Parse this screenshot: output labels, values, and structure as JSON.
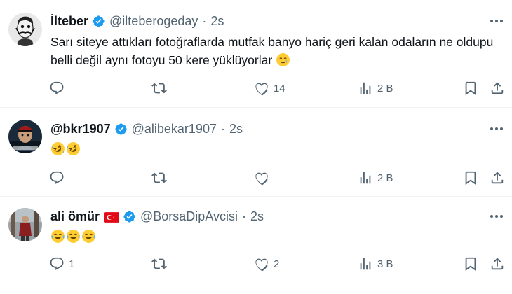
{
  "tweets": [
    {
      "name": "İlteber",
      "handle": "@ilteberogeday",
      "time": "2s",
      "text": "Sarı siteye attıkları fotoğraflarda mutfak banyo hariç geri kalan odaların ne oldupu belli değil aynı fotoyu 50 kere yüklüyorlar",
      "emoji": [
        "smiling-face-with-tear"
      ],
      "replies": "",
      "retweets": "",
      "likes": "14",
      "views": "2 B"
    },
    {
      "name": "@bkr1907",
      "handle": "@alibekar1907",
      "time": "2s",
      "text": "",
      "emoji": [
        "rolling-on-floor-laughing",
        "rolling-on-floor-laughing"
      ],
      "replies": "",
      "retweets": "",
      "likes": "",
      "views": "2 B"
    },
    {
      "name": "ali ömür",
      "handle": "@BorsaDipAvcisi",
      "time": "2s",
      "text": "",
      "emoji": [
        "face-with-tears-of-joy",
        "face-with-tears-of-joy",
        "face-with-tears-of-joy"
      ],
      "replies": "1",
      "retweets": "",
      "likes": "2",
      "views": "3 B"
    }
  ],
  "separator": "·",
  "colors": {
    "text": "#0f1419",
    "secondary": "#536471",
    "verified": "#1d9bf0",
    "divider": "#eff3f4",
    "flag_red": "#e30a17"
  },
  "icons": [
    "reply-icon",
    "retweet-icon",
    "like-icon",
    "views-icon",
    "bookmark-icon",
    "share-icon",
    "more-icon",
    "verified-badge-icon"
  ]
}
